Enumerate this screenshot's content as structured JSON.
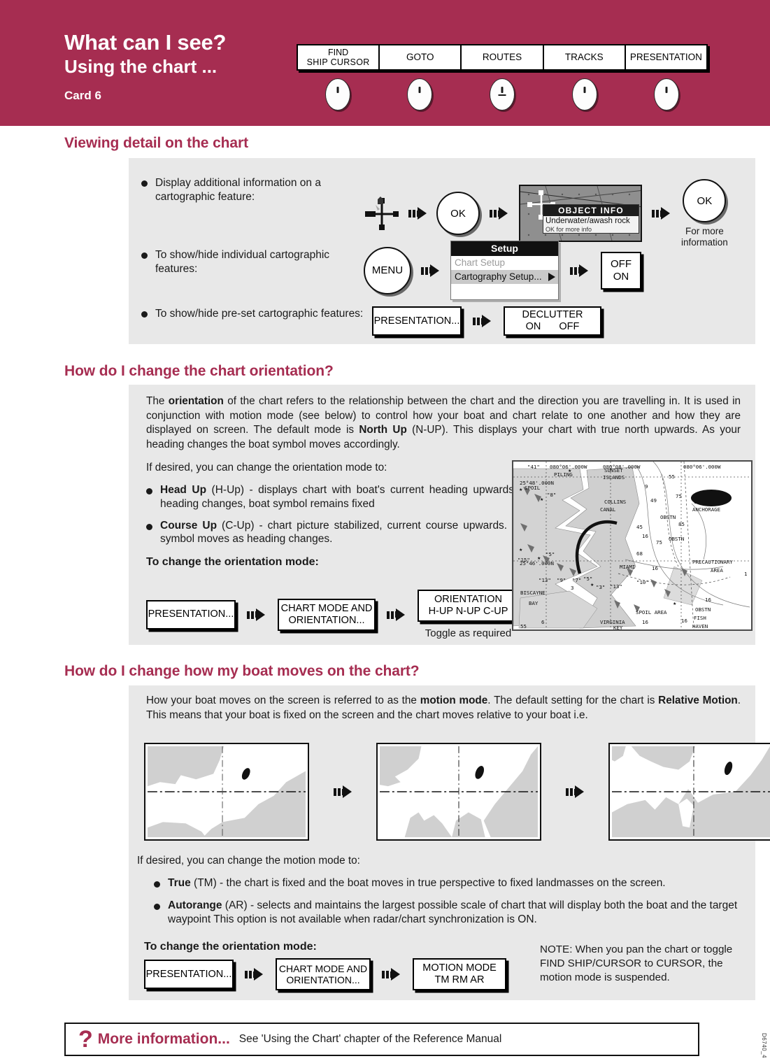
{
  "header": {
    "title_main": "What can I see?",
    "title_sub": "Using the chart ...",
    "card_label": "Card 6",
    "brand_color": "#a62d51",
    "softkeys": [
      {
        "line1": "FIND",
        "line2": "SHIP   CURSOR",
        "two_line": true,
        "key_style": "dash"
      },
      {
        "line1": "GOTO",
        "line2": "",
        "two_line": false,
        "key_style": "dash"
      },
      {
        "line1": "ROUTES",
        "line2": "",
        "two_line": false,
        "key_style": "dash-underline"
      },
      {
        "line1": "TRACKS",
        "line2": "",
        "two_line": false,
        "key_style": "dash"
      },
      {
        "line1": "PRESENTATION",
        "line2": "",
        "two_line": false,
        "key_style": "dash"
      }
    ]
  },
  "section1": {
    "heading": "Viewing detail on the chart",
    "rows": [
      {
        "bullet": "Display additional information on a cartographic feature:"
      },
      {
        "bullet": "To show/hide individual cartographic features:"
      },
      {
        "bullet": "To show/hide pre-set cartographic features:"
      }
    ],
    "ok_key": "OK",
    "ok_key_2": "OK",
    "for_more_information": "For more\ninformation",
    "for_more_line1": "For more",
    "for_more_line2": "information",
    "objinfo": {
      "title": "OBJECT INFO",
      "line1": "Underwater/awash rock",
      "line2": "OK for more info"
    },
    "menu_key": "MENU",
    "setup": {
      "title": "Setup",
      "item1": "Chart Setup",
      "item2": "Cartography Setup..."
    },
    "offon": {
      "line1": "OFF",
      "line2": "ON"
    },
    "presentation_key": "PRESENTATION...",
    "declutter": {
      "line1": "DECLUTTER",
      "on": "ON",
      "off": "OFF"
    }
  },
  "section2": {
    "heading": "How do I change the chart orientation?",
    "paragraph_parts": [
      {
        "text": "The ",
        "bold": false
      },
      {
        "text": "orientation",
        "bold": true
      },
      {
        "text": " of the chart refers to the relationship between the chart and the direction you are travelling in.  It is used in conjunction with motion mode (see below) to control how your boat and chart relate to one another and how they are displayed on screen.  The default mode is ",
        "bold": false
      },
      {
        "text": "North Up",
        "bold": true
      },
      {
        "text": " (N-UP).  This displays your chart with true north upwards.  As your heading changes the boat symbol moves accordingly.",
        "bold": false
      }
    ],
    "intro": "If desired, you can change the orientation mode to:",
    "bullets": [
      {
        "bold": "Head Up",
        "rest": " (H-Up) - displays chart with boat's current heading upwards.  As heading changes, boat symbol remains fixed"
      },
      {
        "bold": "Course Up",
        "rest": " (C-Up) - chart picture stabilized, current course upwards.  Boat symbol moves as heading changes."
      }
    ],
    "to_change": "To change the orientation mode:",
    "flow": [
      {
        "line1": "PRESENTATION...",
        "line2": ""
      },
      {
        "line1": "CHART MODE AND",
        "line2": "ORIENTATION..."
      },
      {
        "line1": "ORIENTATION",
        "line2": "H-UP  N-UP  C-UP"
      }
    ],
    "toggle_note": "Toggle as required",
    "chart_labels": [
      "\"41\"",
      "080°06'.000W",
      "080°08'.000W",
      "080°06'.000W",
      "PILING",
      "SUNSET",
      "ISLANDS",
      "COLLINS",
      "CANAL",
      "25°48'.000N",
      "25°46'.000N",
      "SPOIL",
      "9",
      "55",
      "49",
      "75",
      "45",
      "16",
      "68",
      "75",
      "85",
      "3",
      "16",
      "16",
      "16",
      "6",
      "55",
      "OBSTN",
      "OBSTN",
      "OBSTN",
      "GENERAL ANCHORAGE",
      "PRECAUTIONARY AREA",
      "MIAMI",
      "BISCAYNE",
      "BAY",
      "VIRGINIA",
      "KEY",
      "SPOIL AREA",
      "FISH HAVEN",
      "\"15\"",
      "\"13\"",
      "\"9\"",
      "\"7\"",
      "\"5\"",
      "\"3\"",
      "\"10\"",
      "\"13\"",
      "\"8\""
    ]
  },
  "section3": {
    "heading": "How do I change how my boat moves on the chart?",
    "paragraph_parts": [
      {
        "text": "How your boat moves on the screen is referred to as the ",
        "bold": false
      },
      {
        "text": "motion mode",
        "bold": true
      },
      {
        "text": ".  The default setting for the chart is ",
        "bold": false
      },
      {
        "text": "Relative Motion",
        "bold": true
      },
      {
        "text": ".  This means that your boat is fixed on the screen and the chart moves relative to your boat i.e.",
        "bold": false
      }
    ],
    "intro": "If desired, you can change the motion mode to:",
    "bullets": [
      {
        "bold": "True",
        "rest": " (TM) - the chart is fixed and the boat moves in true perspective to fixed landmasses on the screen."
      },
      {
        "bold": "Autorange",
        "rest": " (AR) - selects and maintains the largest possible scale of chart that will display both the boat and the target waypoint  This option is not available when radar/chart synchronization is ON."
      }
    ],
    "to_change": "To change the orientation mode:",
    "flow": [
      {
        "line1": "PRESENTATION...",
        "line2": ""
      },
      {
        "line1": "CHART MODE AND",
        "line2": "ORIENTATION..."
      },
      {
        "line1": "MOTION MODE",
        "line2": "TM    RM    AR"
      }
    ],
    "note": "NOTE:  When you pan the chart or toggle FIND SHIP/CURSOR to CURSOR, the motion mode is suspended."
  },
  "footer": {
    "qmark": "?",
    "more_information": "More information...",
    "see_text": "See 'Using the Chart' chapter of the Reference Manual",
    "doc_code": "D6740_4"
  }
}
